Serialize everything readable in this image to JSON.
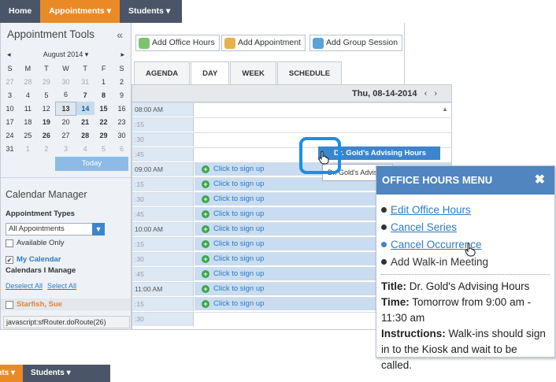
{
  "nav": {
    "home": "Home",
    "appointments": "Appointments",
    "students": "Students",
    "caret": "▾"
  },
  "tools": {
    "title": "Appointment Tools",
    "collapse": "«",
    "month": "August 2014 ▾",
    "prev": "◂",
    "next": "▸",
    "weekdays": [
      "S",
      "M",
      "T",
      "W",
      "T",
      "F",
      "S"
    ],
    "weeks": [
      [
        "27",
        "28",
        "29",
        "30",
        "31",
        "1",
        "2"
      ],
      [
        "3",
        "4",
        "5",
        "6",
        "7",
        "8",
        "9"
      ],
      [
        "10",
        "11",
        "12",
        "13",
        "14",
        "15",
        "16"
      ],
      [
        "17",
        "18",
        "19",
        "20",
        "21",
        "22",
        "23"
      ],
      [
        "24",
        "25",
        "26",
        "27",
        "28",
        "29",
        "30"
      ],
      [
        "31",
        "1",
        "2",
        "3",
        "4",
        "5",
        "6"
      ]
    ],
    "today": "Today"
  },
  "calmgr": {
    "title": "Calendar Manager",
    "types_label": "Appointment Types",
    "select_value": "All Appointments",
    "available_only": "Available Only",
    "my_calendar": "My Calendar",
    "calendars_manage": "Calendars I Manage",
    "deselect_all": "Deselect All",
    "select_all": "Select All",
    "starfish": "Starfish, Sue"
  },
  "status_text": "javascript:sfRouter.doRoute(26)",
  "toolbar": {
    "add_office_hours": "Add Office Hours",
    "add_appointment": "Add Appointment",
    "add_group_session": "Add Group Session",
    "tabs": [
      "AGENDA",
      "DAY",
      "WEEK",
      "SCHEDULE"
    ]
  },
  "day": {
    "date": "Thu, 08-14-2014",
    "prev": "‹",
    "next": "›",
    "times": [
      "08:00 AM",
      ":15",
      ":30",
      ":45",
      "09:00 AM",
      ":15",
      ":30",
      ":45",
      "10:00 AM",
      ":15",
      ":30",
      ":45",
      "11:00 AM",
      ":15",
      ":30"
    ],
    "signup": "Click to sign up",
    "event_title": "Dr. Gold's Advising Hours",
    "event2_title": "Dr. Gold's Advisi"
  },
  "menu": {
    "title": "OFFICE HOURS MENU",
    "close": "✖",
    "items": [
      "Edit Office Hours",
      "Cancel Series",
      "Cancel Occurrence",
      "Add Walk-in Meeting"
    ],
    "title_label": "Title:",
    "title_value": "Dr. Gold's Advising Hours",
    "time_label": "Time:",
    "time_value": "Tomorrow from 9:00 am - 11:30 am",
    "instr_label": "Instructions:",
    "instr_value": "Walk-ins should sign in to the Kiosk and wait to be called."
  },
  "colors": {
    "nav_bg": "#4a5667",
    "nav_active": "#ea8a27",
    "accent": "#3c85cc",
    "menu_header": "#4f86bf",
    "slot_blue": "#c9dcf0"
  }
}
